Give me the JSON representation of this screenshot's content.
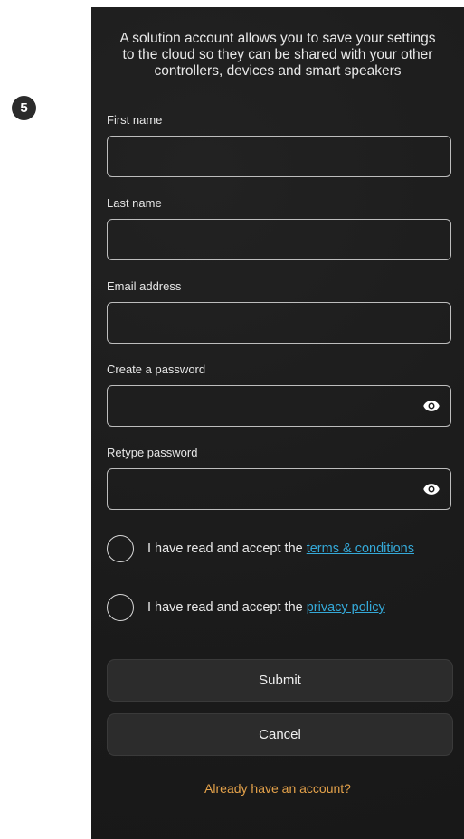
{
  "step_badge": "5",
  "intro": "A solution account allows you to save your settings\nto the cloud so they can be shared with your other\ncontrollers, devices and smart speakers",
  "form": {
    "first_name": {
      "label": "First name",
      "value": "",
      "placeholder": ""
    },
    "last_name": {
      "label": "Last name",
      "value": "",
      "placeholder": ""
    },
    "email": {
      "label": "Email address",
      "value": "",
      "placeholder": ""
    },
    "password": {
      "label": "Create a password",
      "value": "",
      "placeholder": ""
    },
    "retype_password": {
      "label": "Retype password",
      "value": "",
      "placeholder": ""
    }
  },
  "consents": {
    "terms": {
      "text": "I have read and accept the",
      "link": "terms & conditions",
      "checked": false
    },
    "privacy": {
      "text": "I have read and accept the",
      "link": "privacy policy",
      "checked": false
    }
  },
  "buttons": {
    "submit": "Submit",
    "cancel": "Cancel"
  },
  "account_link": "Already have an account?",
  "icons": {
    "password_visibility": "eye-icon",
    "step": "step-number-badge"
  },
  "colors": {
    "background": "#1c1c1c",
    "link": "#35a9d8",
    "account_link": "#e3a14a",
    "badge": "#2b2b2b"
  }
}
